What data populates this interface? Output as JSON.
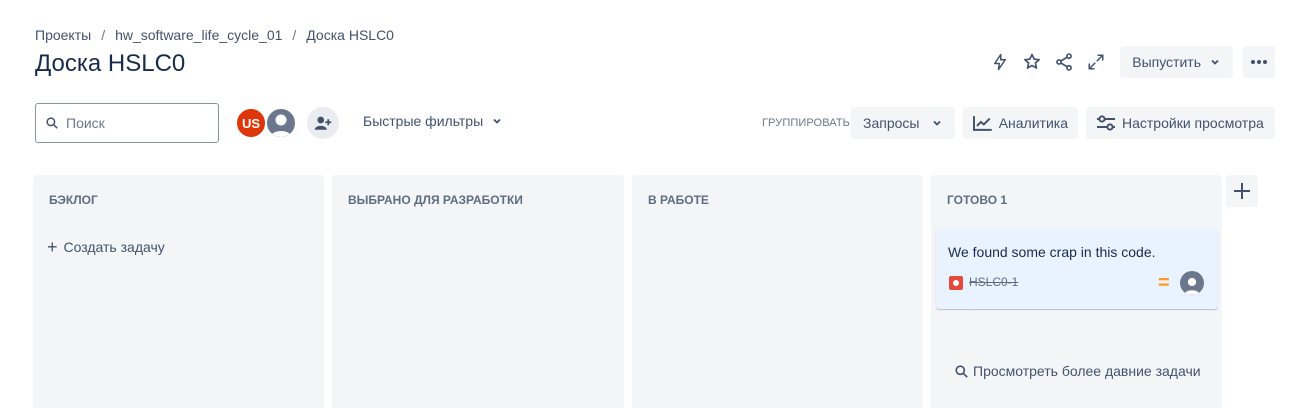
{
  "breadcrumb": {
    "projects": "Проекты",
    "separator": "/",
    "project": "hw_software_life_cycle_01",
    "board": "Доска HSLC0"
  },
  "page": {
    "title": "Доска HSLC0"
  },
  "header_actions": {
    "icons": [
      "lightning-icon",
      "star-icon",
      "share-icon",
      "expand-icon",
      "more-icon"
    ],
    "release_label": "Выпустить"
  },
  "toolbar": {
    "search_placeholder": "Поиск",
    "avatar_initials": "US",
    "quick_filters_label": "Быстрые фильтры",
    "group_by_label": "ГРУППИРОВАТЬ",
    "group_by_value": "Запросы",
    "analytics_label": "Аналитика",
    "view_settings_label": "Настройки просмотра"
  },
  "columns": [
    {
      "title": "БЭКЛОГ",
      "create_label": "Создать задачу"
    },
    {
      "title": "ВЫБРАНО ДЛЯ РАЗРАБОТКИ"
    },
    {
      "title": "В РАБОТЕ"
    },
    {
      "title": "ГОТОВО 1",
      "card": {
        "summary": "We found some crap in this code.",
        "key": "HSLC0-1",
        "type": "bug",
        "priority": "medium"
      },
      "older_link": "Просмотреть более давние задачи"
    }
  ],
  "colors": {
    "avatar_us": "#de350b",
    "card_bg": "#e9f2ff",
    "bug": "#e5493a",
    "priority_medium": "#ff991f",
    "column_bg": "#f4f5f7"
  }
}
